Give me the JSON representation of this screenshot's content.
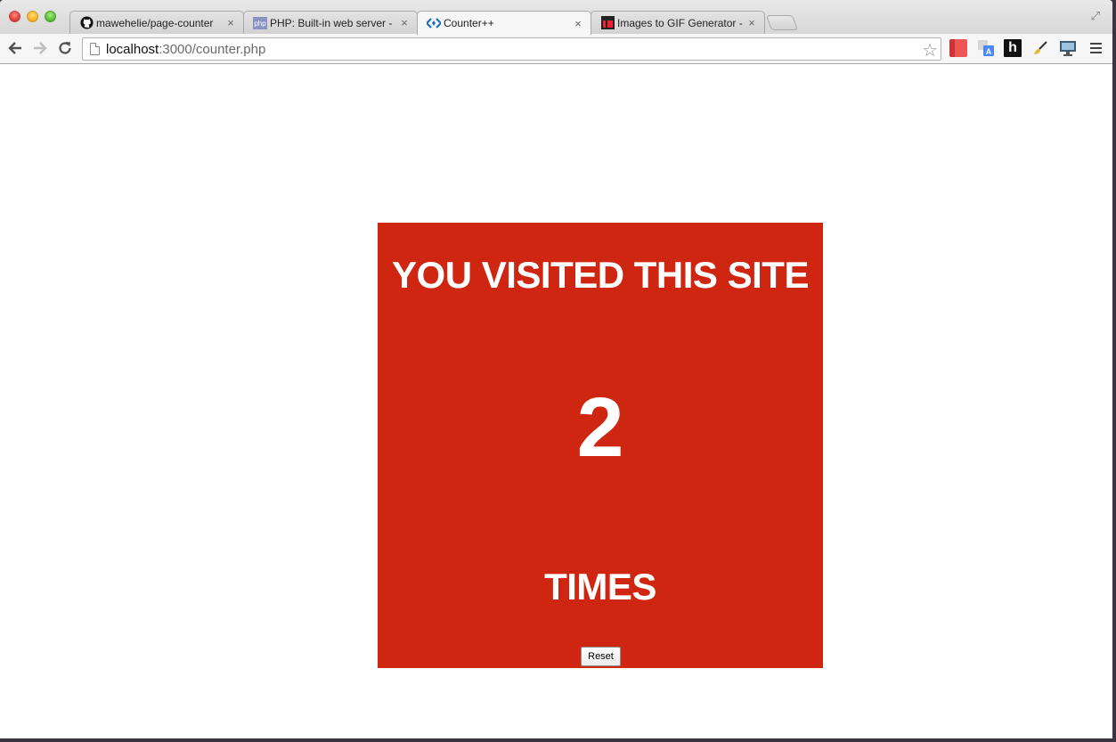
{
  "browser": {
    "tabs": [
      {
        "title": "mawehelie/page-counter",
        "favicon": "github-icon",
        "active": false
      },
      {
        "title": "PHP: Built-in web server -",
        "favicon": "php-icon",
        "active": false
      },
      {
        "title": "Counter++",
        "favicon": "code-icon",
        "active": true
      },
      {
        "title": "Images to GIF Generator -",
        "favicon": "imgflip-icon",
        "active": false
      }
    ],
    "close_glyph": "×",
    "address": {
      "host": "localhost",
      "path": ":3000/counter.php"
    }
  },
  "page": {
    "line1": "YOU VISITED THIS SITE",
    "count": "2",
    "line2": "TIMES",
    "reset_label": "Reset"
  },
  "colors": {
    "counter_background": "#cf2611",
    "counter_text": "#ffffff"
  }
}
